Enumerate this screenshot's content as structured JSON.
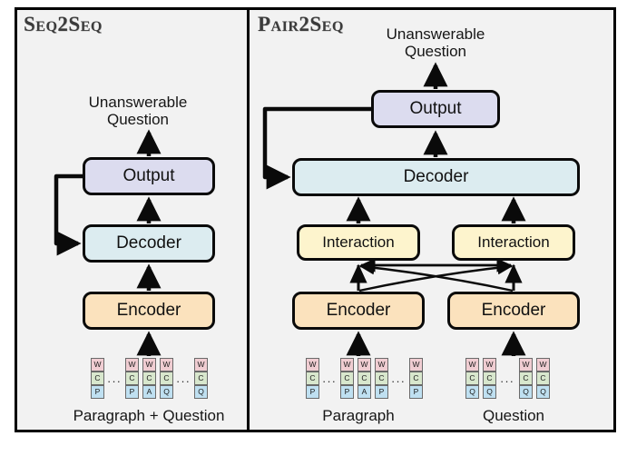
{
  "figure": {
    "background": "#f2f2f2",
    "border_color": "#000000",
    "colors": {
      "output": "#dcdcef",
      "decoder": "#dcecf0",
      "encoder": "#fbe2bd",
      "interaction": "#fdf4cd",
      "token_w": "#f0cdd2",
      "token_c": "#d8e7cd",
      "token_tag": "#bfe0f1"
    }
  },
  "left_panel": {
    "title": "Seq2Seq",
    "output_text": "Unanswerable\nQuestion",
    "nodes": {
      "output": "Output",
      "decoder": "Decoder",
      "encoder": "Encoder"
    },
    "input_label": "Paragraph + Question",
    "tokens": [
      {
        "rows": [
          "W",
          "C",
          "P"
        ]
      },
      {
        "ellipsis": true
      },
      {
        "rows": [
          "W",
          "C",
          "P"
        ]
      },
      {
        "rows": [
          "W",
          "C",
          "A"
        ]
      },
      {
        "rows": [
          "W",
          "C",
          "Q"
        ]
      },
      {
        "ellipsis": true
      },
      {
        "rows": [
          "W",
          "C",
          "Q"
        ]
      }
    ]
  },
  "right_panel": {
    "title": "Pair2Seq",
    "output_text": "Unanswerable\nQuestion",
    "nodes": {
      "output": "Output",
      "decoder": "Decoder",
      "interaction_left": "Interaction",
      "interaction_right": "Interaction",
      "encoder_left": "Encoder",
      "encoder_right": "Encoder"
    },
    "input_label_left": "Paragraph",
    "input_label_right": "Question",
    "tokens_left": [
      {
        "rows": [
          "W",
          "C",
          "P"
        ]
      },
      {
        "ellipsis": true
      },
      {
        "rows": [
          "W",
          "C",
          "P"
        ]
      },
      {
        "rows": [
          "W",
          "C",
          "A"
        ]
      },
      {
        "rows": [
          "W",
          "C",
          "P"
        ]
      },
      {
        "ellipsis": true
      },
      {
        "rows": [
          "W",
          "C",
          "P"
        ]
      }
    ],
    "tokens_right": [
      {
        "rows": [
          "W",
          "C",
          "Q"
        ]
      },
      {
        "rows": [
          "W",
          "C",
          "Q"
        ]
      },
      {
        "ellipsis": true
      },
      {
        "rows": [
          "W",
          "C",
          "Q"
        ]
      },
      {
        "rows": [
          "W",
          "C",
          "Q"
        ]
      }
    ]
  }
}
